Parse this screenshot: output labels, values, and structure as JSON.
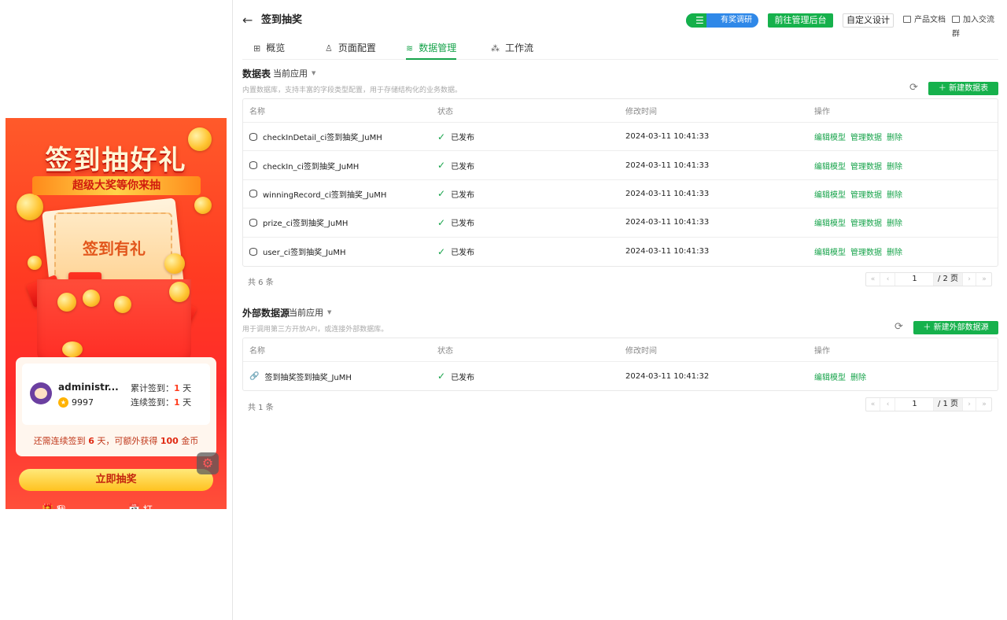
{
  "header": {
    "back_icon": "arrow-left-icon",
    "title": "签到抽奖",
    "survey_label": "有奖调研",
    "goto_admin": "前往管理后台",
    "custom_design": "自定义设计",
    "docs": "产品文档",
    "join_group": "加入交流群"
  },
  "tabs": [
    {
      "label": "概览",
      "icon": "grid-icon"
    },
    {
      "label": "页面配置",
      "icon": "user-config-icon"
    },
    {
      "label": "数据管理",
      "icon": "database-icon"
    },
    {
      "label": "工作流",
      "icon": "workflow-icon"
    }
  ],
  "active_tab": "数据管理",
  "preview": {
    "title": "签到抽好礼",
    "ribbon": "超级大奖等你来抽",
    "ticket_text": "签到有礼",
    "username": "administr...",
    "coins": "9997",
    "total_label": "累计签到：",
    "total_value": "1",
    "streak_label": "连续签到：",
    "streak_value": "1",
    "day_unit": "天",
    "tip_prefix": "还需连续签到",
    "tip_days": "6",
    "tip_mid": "天，可额外获得",
    "tip_coins": "100",
    "tip_suffix": "金币",
    "draw_button": "立即抽奖",
    "link_prizes": "我的奖品",
    "link_records": "打卡记录"
  },
  "data_tables": {
    "title": "数据表",
    "filter": "当前应用",
    "description": "内置数据库，支持丰富的字段类型配置，用于存储结构化的业务数据。",
    "new_button": "＋ 新建数据表",
    "columns": [
      "名称",
      "状态",
      "修改时间",
      "操作"
    ],
    "rows": [
      {
        "name": "checkInDetail_ci签到抽奖_JuMH",
        "status": "已发布",
        "modified": "2024-03-11 10:41:33",
        "ops": [
          "编辑模型",
          "管理数据",
          "删除"
        ]
      },
      {
        "name": "checkIn_ci签到抽奖_JuMH",
        "status": "已发布",
        "modified": "2024-03-11 10:41:33",
        "ops": [
          "编辑模型",
          "管理数据",
          "删除"
        ]
      },
      {
        "name": "winningRecord_ci签到抽奖_JuMH",
        "status": "已发布",
        "modified": "2024-03-11 10:41:33",
        "ops": [
          "编辑模型",
          "管理数据",
          "删除"
        ]
      },
      {
        "name": "prize_ci签到抽奖_JuMH",
        "status": "已发布",
        "modified": "2024-03-11 10:41:33",
        "ops": [
          "编辑模型",
          "管理数据",
          "删除"
        ]
      },
      {
        "name": "user_ci签到抽奖_JuMH",
        "status": "已发布",
        "modified": "2024-03-11 10:41:33",
        "ops": [
          "编辑模型",
          "管理数据",
          "删除"
        ]
      }
    ],
    "total": "共 6 条",
    "page": "1",
    "pages": "/ 2 页"
  },
  "external_sources": {
    "title": "外部数据源",
    "filter": "当前应用",
    "description": "用于调用第三方开放API，或连接外部数据库。",
    "new_button": "＋ 新建外部数据源",
    "columns": [
      "名称",
      "状态",
      "修改时间",
      "操作"
    ],
    "rows": [
      {
        "name": "签到抽奖签到抽奖_JuMH",
        "status": "已发布",
        "modified": "2024-03-11 10:41:32",
        "ops": [
          "编辑模型",
          "删除"
        ]
      }
    ],
    "total": "共 1 条",
    "page": "1",
    "pages": "/ 1 页"
  },
  "colors": {
    "primary": "#16b14c",
    "accent_blue": "#2f88e8",
    "preview_red": "#ff3b22"
  }
}
